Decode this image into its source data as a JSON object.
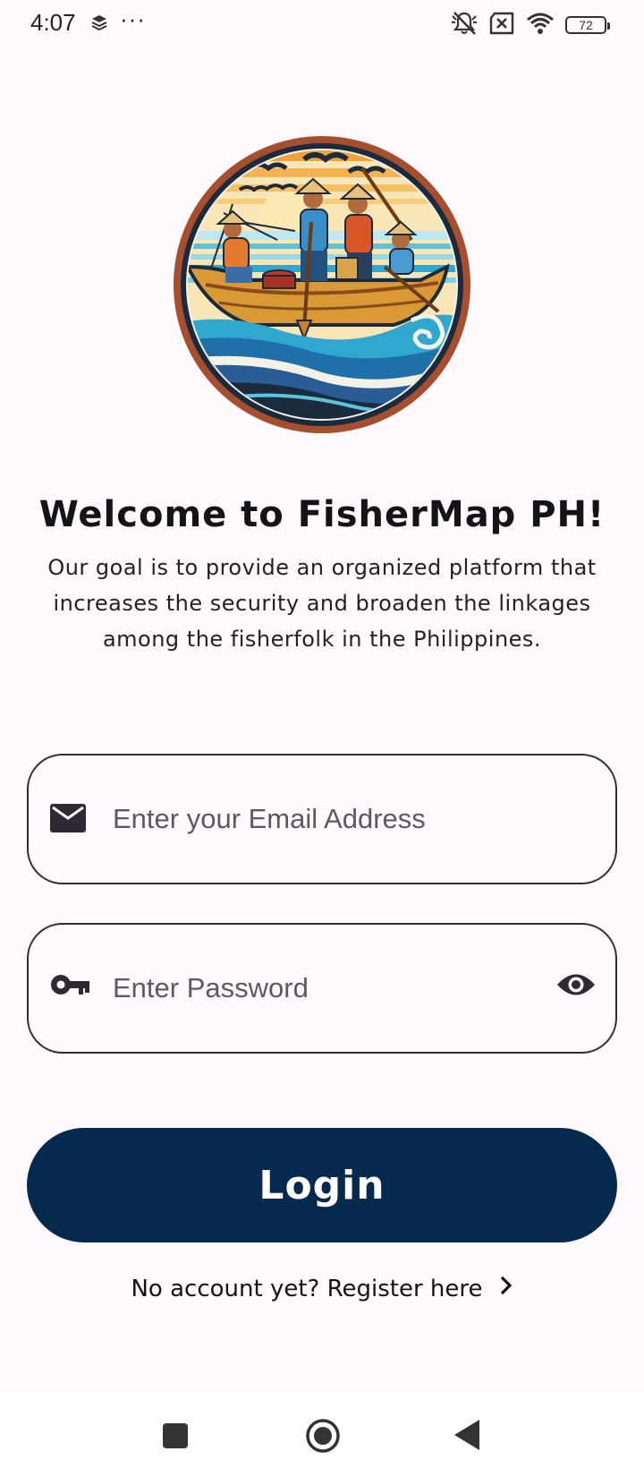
{
  "status_bar": {
    "time": "4:07",
    "more": "···",
    "battery": "72",
    "icons": [
      "layers-icon",
      "mute-icon",
      "no-sim-icon",
      "wifi-icon",
      "battery-icon"
    ]
  },
  "welcome": {
    "title": "Welcome to FisherMap PH!",
    "description": "Our goal is to provide an organized platform that increases the security and broaden the linkages among the fisherfolk in the Philippines."
  },
  "email_field": {
    "placeholder": "Enter your Email Address",
    "value": "",
    "icon": "mail-icon"
  },
  "password_field": {
    "placeholder": "Enter Password",
    "value": "",
    "icon": "key-icon",
    "toggle_icon": "eye-icon"
  },
  "login_button": {
    "label": "Login"
  },
  "register": {
    "label": "No account yet? Register here",
    "icon": "chevron-right-icon"
  },
  "nav_bar": {
    "icons": [
      "recents-square-icon",
      "home-circle-icon",
      "back-triangle-icon"
    ]
  },
  "colors": {
    "background": "#fff8fc",
    "primary": "#062a4d",
    "outline": "#2d2d33",
    "logo_ring": "#a64f2e"
  }
}
